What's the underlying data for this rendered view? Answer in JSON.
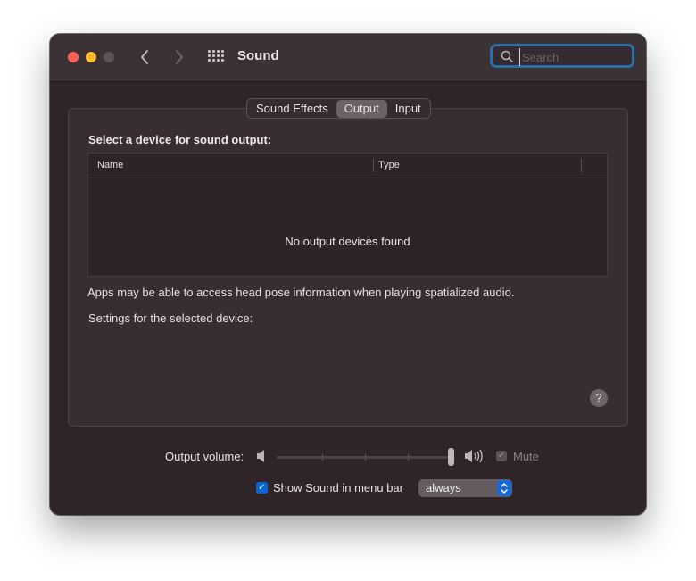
{
  "window": {
    "title": "Sound",
    "search_placeholder": "Search"
  },
  "tabs": [
    {
      "label": "Sound Effects",
      "active": false
    },
    {
      "label": "Output",
      "active": true
    },
    {
      "label": "Input",
      "active": false
    }
  ],
  "output": {
    "section_label": "Select a device for sound output:",
    "columns": [
      "Name",
      "Type"
    ],
    "empty_message": "No output devices found",
    "info_text": "Apps may be able to access head pose information when playing spatialized audio.",
    "settings_label": "Settings for the selected device:"
  },
  "help": {
    "label": "?"
  },
  "volume": {
    "label": "Output volume:",
    "level": 1.0,
    "mute_label": "Mute",
    "mute_checked": true,
    "mute_enabled": false
  },
  "menu_bar": {
    "label": "Show Sound in menu bar",
    "checked": true,
    "option": "always"
  },
  "colors": {
    "close": "#fe5f57",
    "minimize": "#febc2e",
    "accent": "#0a67d2",
    "focus_ring": "#2b6ea6"
  }
}
